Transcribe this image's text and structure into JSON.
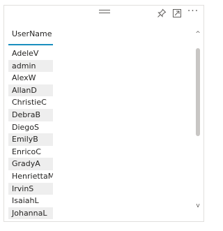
{
  "visual": {
    "header": {
      "drag_handle_icon": "drag-handle-icon",
      "pin_icon": "pin-icon",
      "focus_icon": "focus-mode-icon",
      "more_label": "···"
    },
    "table": {
      "column_header": "UserName",
      "rows": [
        "AdeleV",
        "admin",
        "AlexW",
        "AllanD",
        "ChristieC",
        "DebraB",
        "DiegoS",
        "EmilyB",
        "EnricoC",
        "GradyA",
        "HenriettaM",
        "IrvinS",
        "IsaiahL",
        "JohannaL"
      ]
    },
    "scrollbar": {
      "up_arrow": "^",
      "down_arrow": "v"
    }
  }
}
